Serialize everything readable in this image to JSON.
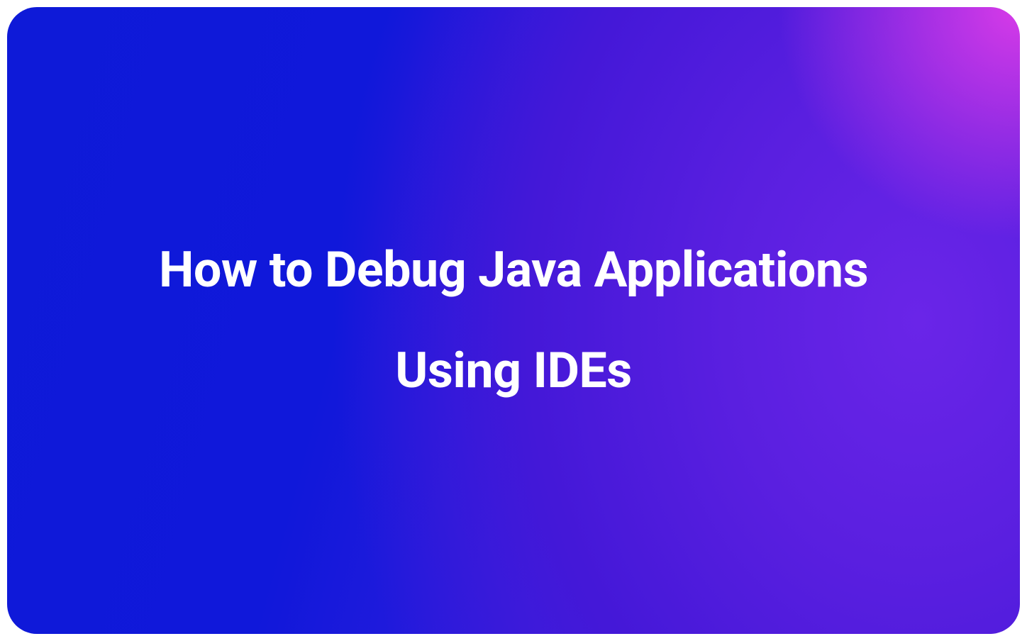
{
  "title": {
    "line1": "How to Debug Java Applications",
    "line2": "Using IDEs"
  },
  "colors": {
    "gradient_start": "#0e1ad8",
    "gradient_mid": "#5825e5",
    "gradient_accent": "#d83be8",
    "text": "#ffffff"
  }
}
